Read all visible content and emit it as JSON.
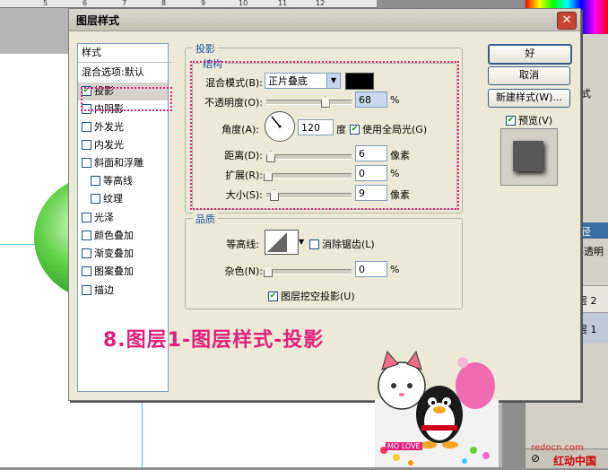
{
  "background": {
    "ruler_ticks": [
      "5",
      "6",
      "7",
      "8",
      "9",
      "10",
      "11",
      "12"
    ],
    "right_panel": {
      "rows": [
        "式",
        "",
        "",
        "",
        "",
        "",
        "",
        "",
        ""
      ],
      "layers_title": "径",
      "layers_opacity_label": "不透明",
      "layer_items": [
        "层 2",
        "层 1"
      ],
      "bottom_icons": [
        "circle-icon",
        "adjust-icon",
        "folder-icon",
        "new-layer-icon",
        "trash-icon"
      ]
    }
  },
  "dialog": {
    "title": "图层样式",
    "close_glyph": "✕",
    "style_list": {
      "header": "样式",
      "blend_default": "混合选项:默认",
      "items": [
        {
          "label": "投影",
          "checked": true,
          "indent": false
        },
        {
          "label": "内阴影",
          "checked": false,
          "indent": false
        },
        {
          "label": "外发光",
          "checked": false,
          "indent": false
        },
        {
          "label": "内发光",
          "checked": false,
          "indent": false
        },
        {
          "label": "斜面和浮雕",
          "checked": false,
          "indent": false
        },
        {
          "label": "等高线",
          "checked": false,
          "indent": true
        },
        {
          "label": "纹理",
          "checked": false,
          "indent": true
        },
        {
          "label": "光泽",
          "checked": false,
          "indent": false
        },
        {
          "label": "颜色叠加",
          "checked": false,
          "indent": false
        },
        {
          "label": "渐变叠加",
          "checked": false,
          "indent": false
        },
        {
          "label": "图案叠加",
          "checked": false,
          "indent": false
        },
        {
          "label": "描边",
          "checked": false,
          "indent": false
        }
      ]
    },
    "shadow_group": {
      "title": "投影",
      "structure_title": "结构",
      "blend_mode_label": "混合模式(B):",
      "blend_mode_value": "正片叠底",
      "shadow_color": "#000000",
      "opacity_label": "不透明度(O):",
      "opacity_value": "68",
      "opacity_unit": "%",
      "opacity_fraction": 0.68,
      "angle_label": "角度(A):",
      "angle_value": "120",
      "angle_unit": "度",
      "global_light_label": "使用全局光(G)",
      "global_light_checked": true,
      "distance_label": "距离(D):",
      "distance_value": "6",
      "distance_unit": "像素",
      "spread_label": "扩展(R):",
      "spread_value": "0",
      "spread_unit": "%",
      "size_label": "大小(S):",
      "size_value": "9",
      "size_unit": "像素"
    },
    "quality_group": {
      "title": "品质",
      "contour_label": "等高线:",
      "antialias_label": "消除锯齿(L)",
      "antialias_checked": false,
      "noise_label": "杂色(N):",
      "noise_value": "0",
      "noise_unit": "%",
      "knockout_label": "图层挖空投影(U)",
      "knockout_checked": true
    },
    "buttons": {
      "ok": "好",
      "cancel": "取消",
      "new_style": "新建样式(W)...",
      "preview_label": "预览(V)",
      "preview_checked": true
    }
  },
  "overlay": {
    "caption": "8.图层1-图层样式-投影",
    "sticker_text": "MO LOVE",
    "watermark": "redocn.com",
    "watermark_cn": "红动中国"
  },
  "colors": {
    "highlight": "#e0207a",
    "group_title": "#1a4fa0",
    "guide": "#4fc0d8",
    "close": "#c84533"
  }
}
